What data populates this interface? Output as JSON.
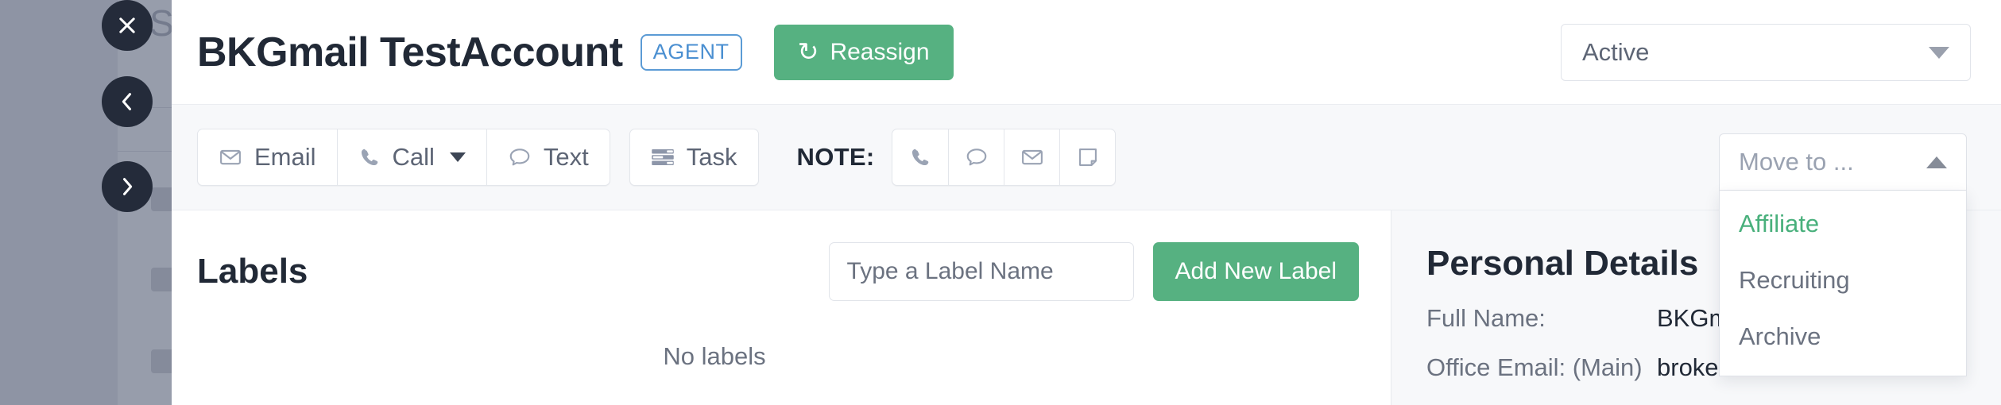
{
  "backdrop": {
    "partial_text": "S"
  },
  "nav": {
    "close_label": "✕",
    "prev_label": "‹",
    "next_label": "›"
  },
  "header": {
    "title": "BKGmail TestAccount",
    "badge": "AGENT",
    "reassign_label": "Reassign",
    "reassign_icon": "refresh-icon",
    "reassign_color": "#56b181",
    "badge_color": "#4a8fd1",
    "status": {
      "value": "Active",
      "icon": "chevron-down-icon"
    }
  },
  "toolbar": {
    "email_label": "Email",
    "call_label": "Call",
    "text_label": "Text",
    "task_label": "Task",
    "note_label": "NOTE:",
    "note_icons": [
      "phone-icon",
      "chat-bubble-icon",
      "envelope-icon",
      "note-page-icon"
    ]
  },
  "labels": {
    "title": "Labels",
    "input_placeholder": "Type a Label Name",
    "input_value": "",
    "add_button": "Add New Label",
    "empty_text": "No labels"
  },
  "personal_details": {
    "title": "Personal Details",
    "rows": [
      {
        "key": "Full Name:",
        "value": "BKGmai"
      },
      {
        "key": "Office Email: (Main)",
        "value": "brokerk"
      }
    ]
  },
  "move_to": {
    "placeholder": "Move to ...",
    "icon": "chevron-up-icon",
    "options": [
      {
        "label": "Affiliate",
        "highlighted": true
      },
      {
        "label": "Recruiting",
        "highlighted": false
      },
      {
        "label": "Archive",
        "highlighted": false
      }
    ],
    "highlight_color": "#49b07c"
  }
}
